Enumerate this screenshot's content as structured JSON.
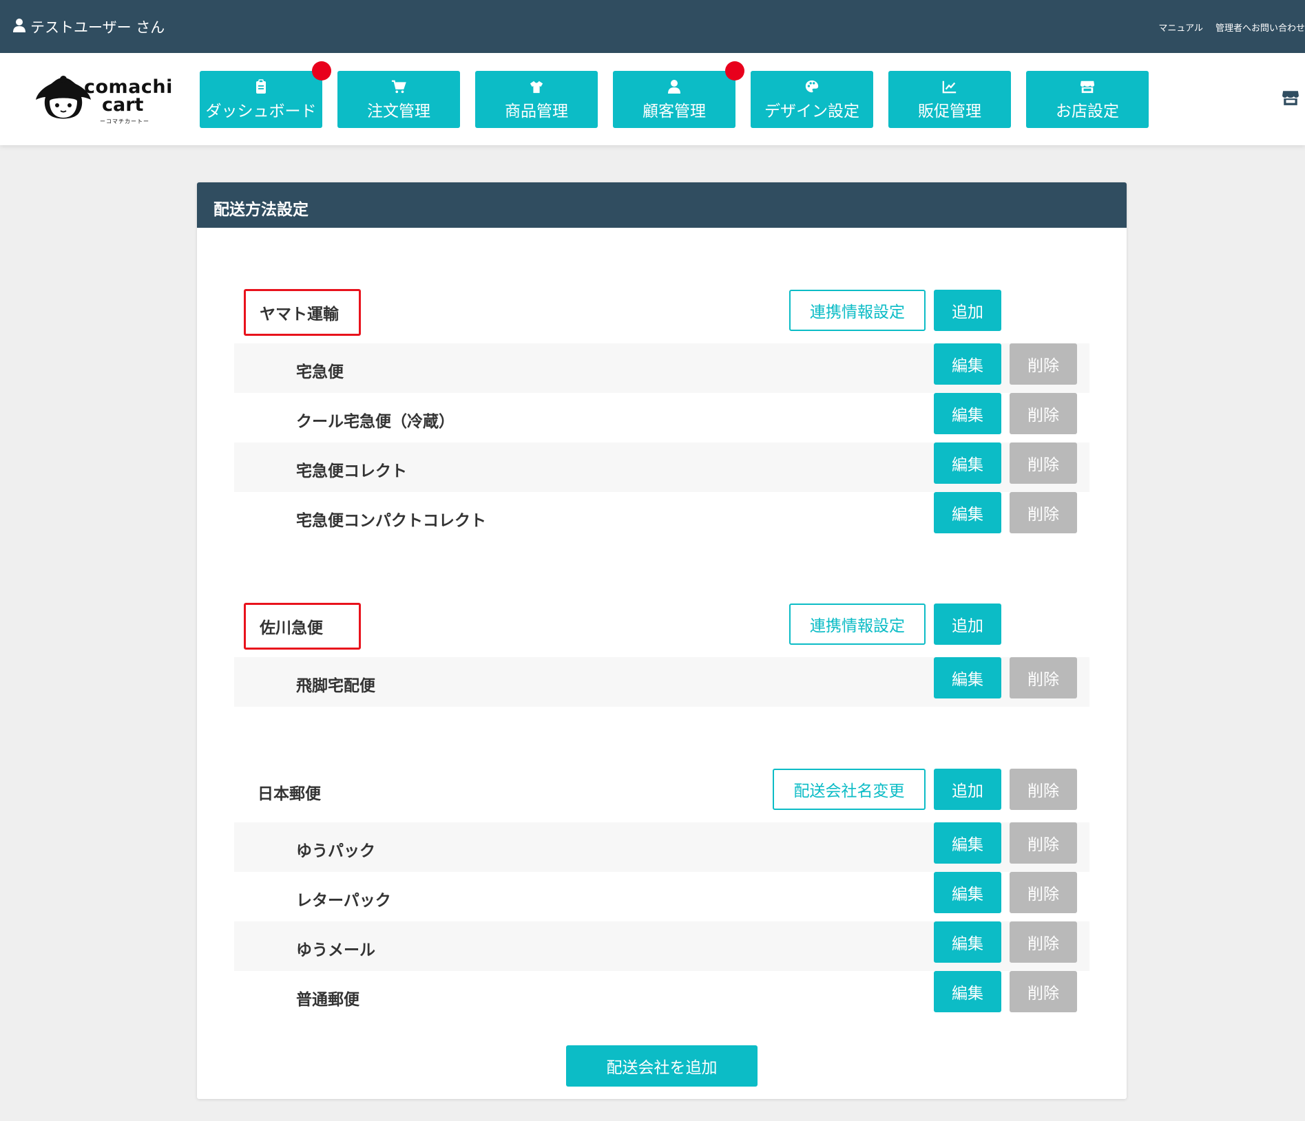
{
  "topbar": {
    "user_label": "テストユーザー さん",
    "manual_link": "マニュアル",
    "contact_link": "管理者へお問い合わせ"
  },
  "logo": {
    "line1": "comachi",
    "line2": "cart",
    "line3": "ーコマチカートー"
  },
  "nav": {
    "dashboard": "ダッシュボード",
    "orders": "注文管理",
    "products": "商品管理",
    "customers": "顧客管理",
    "design": "デザイン設定",
    "promotion": "販促管理",
    "store": "お店設定"
  },
  "colors": {
    "accent": "#0cbcc6",
    "header_bg": "#304d60",
    "badge": "#e8001c",
    "highlight_box": "#e8121c",
    "disabled_button": "#b9b9b9"
  },
  "panel": {
    "title": "配送方法設定",
    "add_company_label": "配送会社を追加"
  },
  "buttons": {
    "link_settings": "連携情報設定",
    "rename_company": "配送会社名変更",
    "add": "追加",
    "edit": "編集",
    "delete": "削除"
  },
  "companies": [
    {
      "name": "ヤマト運輸",
      "methods": [
        "宅急便",
        "クール宅急便（冷蔵）",
        "宅急便コレクト",
        "宅急便コンパクトコレクト"
      ]
    },
    {
      "name": "佐川急便",
      "methods": [
        "飛脚宅配便"
      ]
    },
    {
      "name": "日本郵便",
      "methods": [
        "ゆうパック",
        "レターパック",
        "ゆうメール",
        "普通郵便"
      ]
    }
  ]
}
